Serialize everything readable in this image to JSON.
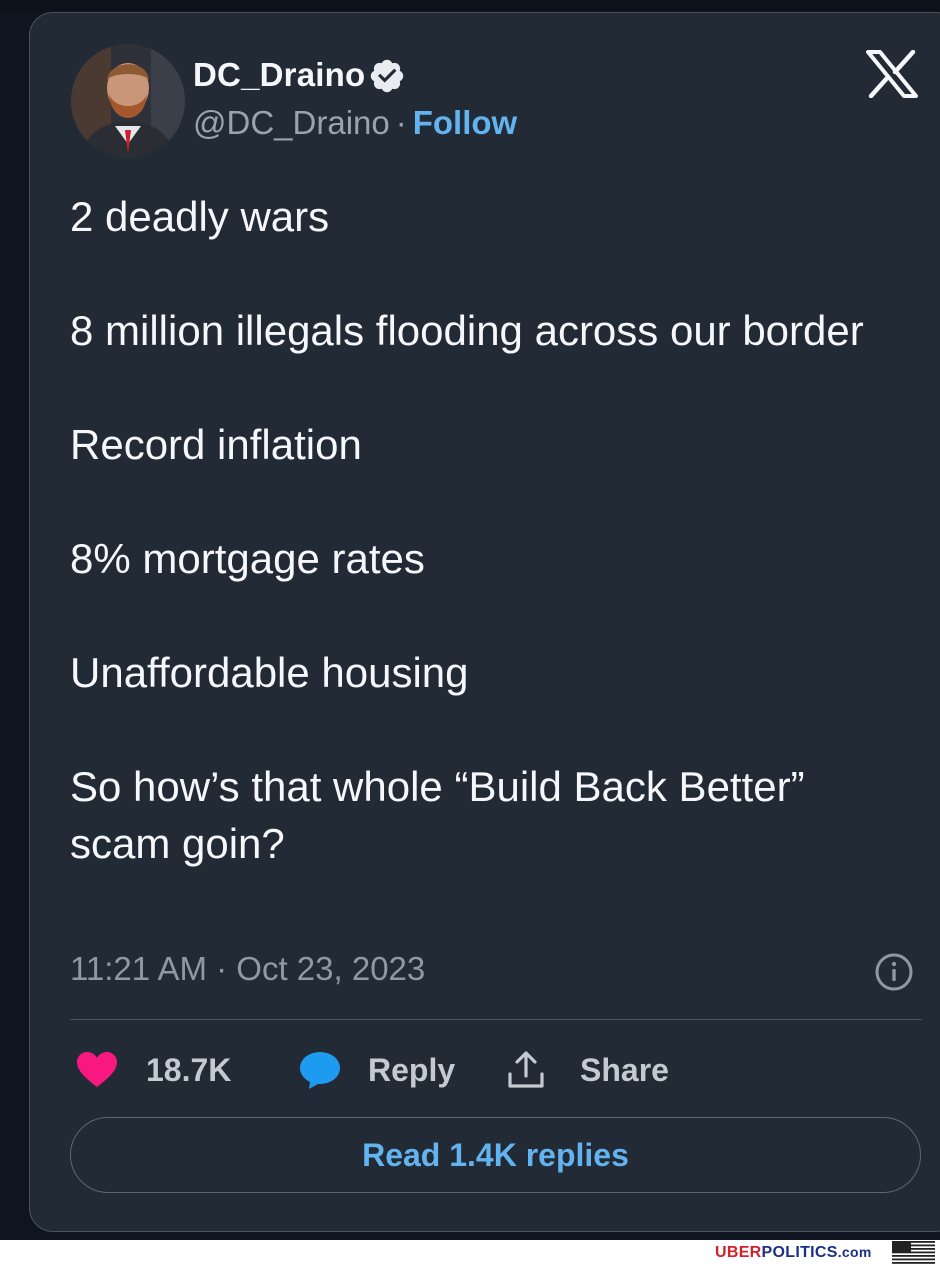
{
  "author": {
    "display_name": "DC_Draino",
    "handle": "@DC_Draino",
    "separator": "·",
    "follow_label": "Follow",
    "verified_icon": "verified-badge-icon",
    "avatar": "profile-photo"
  },
  "platform_logo": "x-logo-icon",
  "tweet": {
    "paragraphs": [
      "2 deadly wars",
      "8 million illegals flooding across our border",
      "Record inflation",
      "8% mortgage rates",
      "Unaffordable housing",
      "So how’s that whole “Build Back Better” scam goin?"
    ],
    "timestamp": "11:21 AM · Oct 23, 2023"
  },
  "actions": {
    "likes_count": "18.7K",
    "reply_label": "Reply",
    "share_label": "Share"
  },
  "read_replies_label": "Read 1.4K replies",
  "watermark": {
    "uber": "UBER",
    "politics": "POLITICS",
    "com": ".com"
  },
  "colors": {
    "background": "#222a35",
    "text": "#f5f7fa",
    "muted": "#8f98a3",
    "accent": "#63b3ee",
    "like": "#f91880",
    "reply": "#1d9bf0"
  }
}
